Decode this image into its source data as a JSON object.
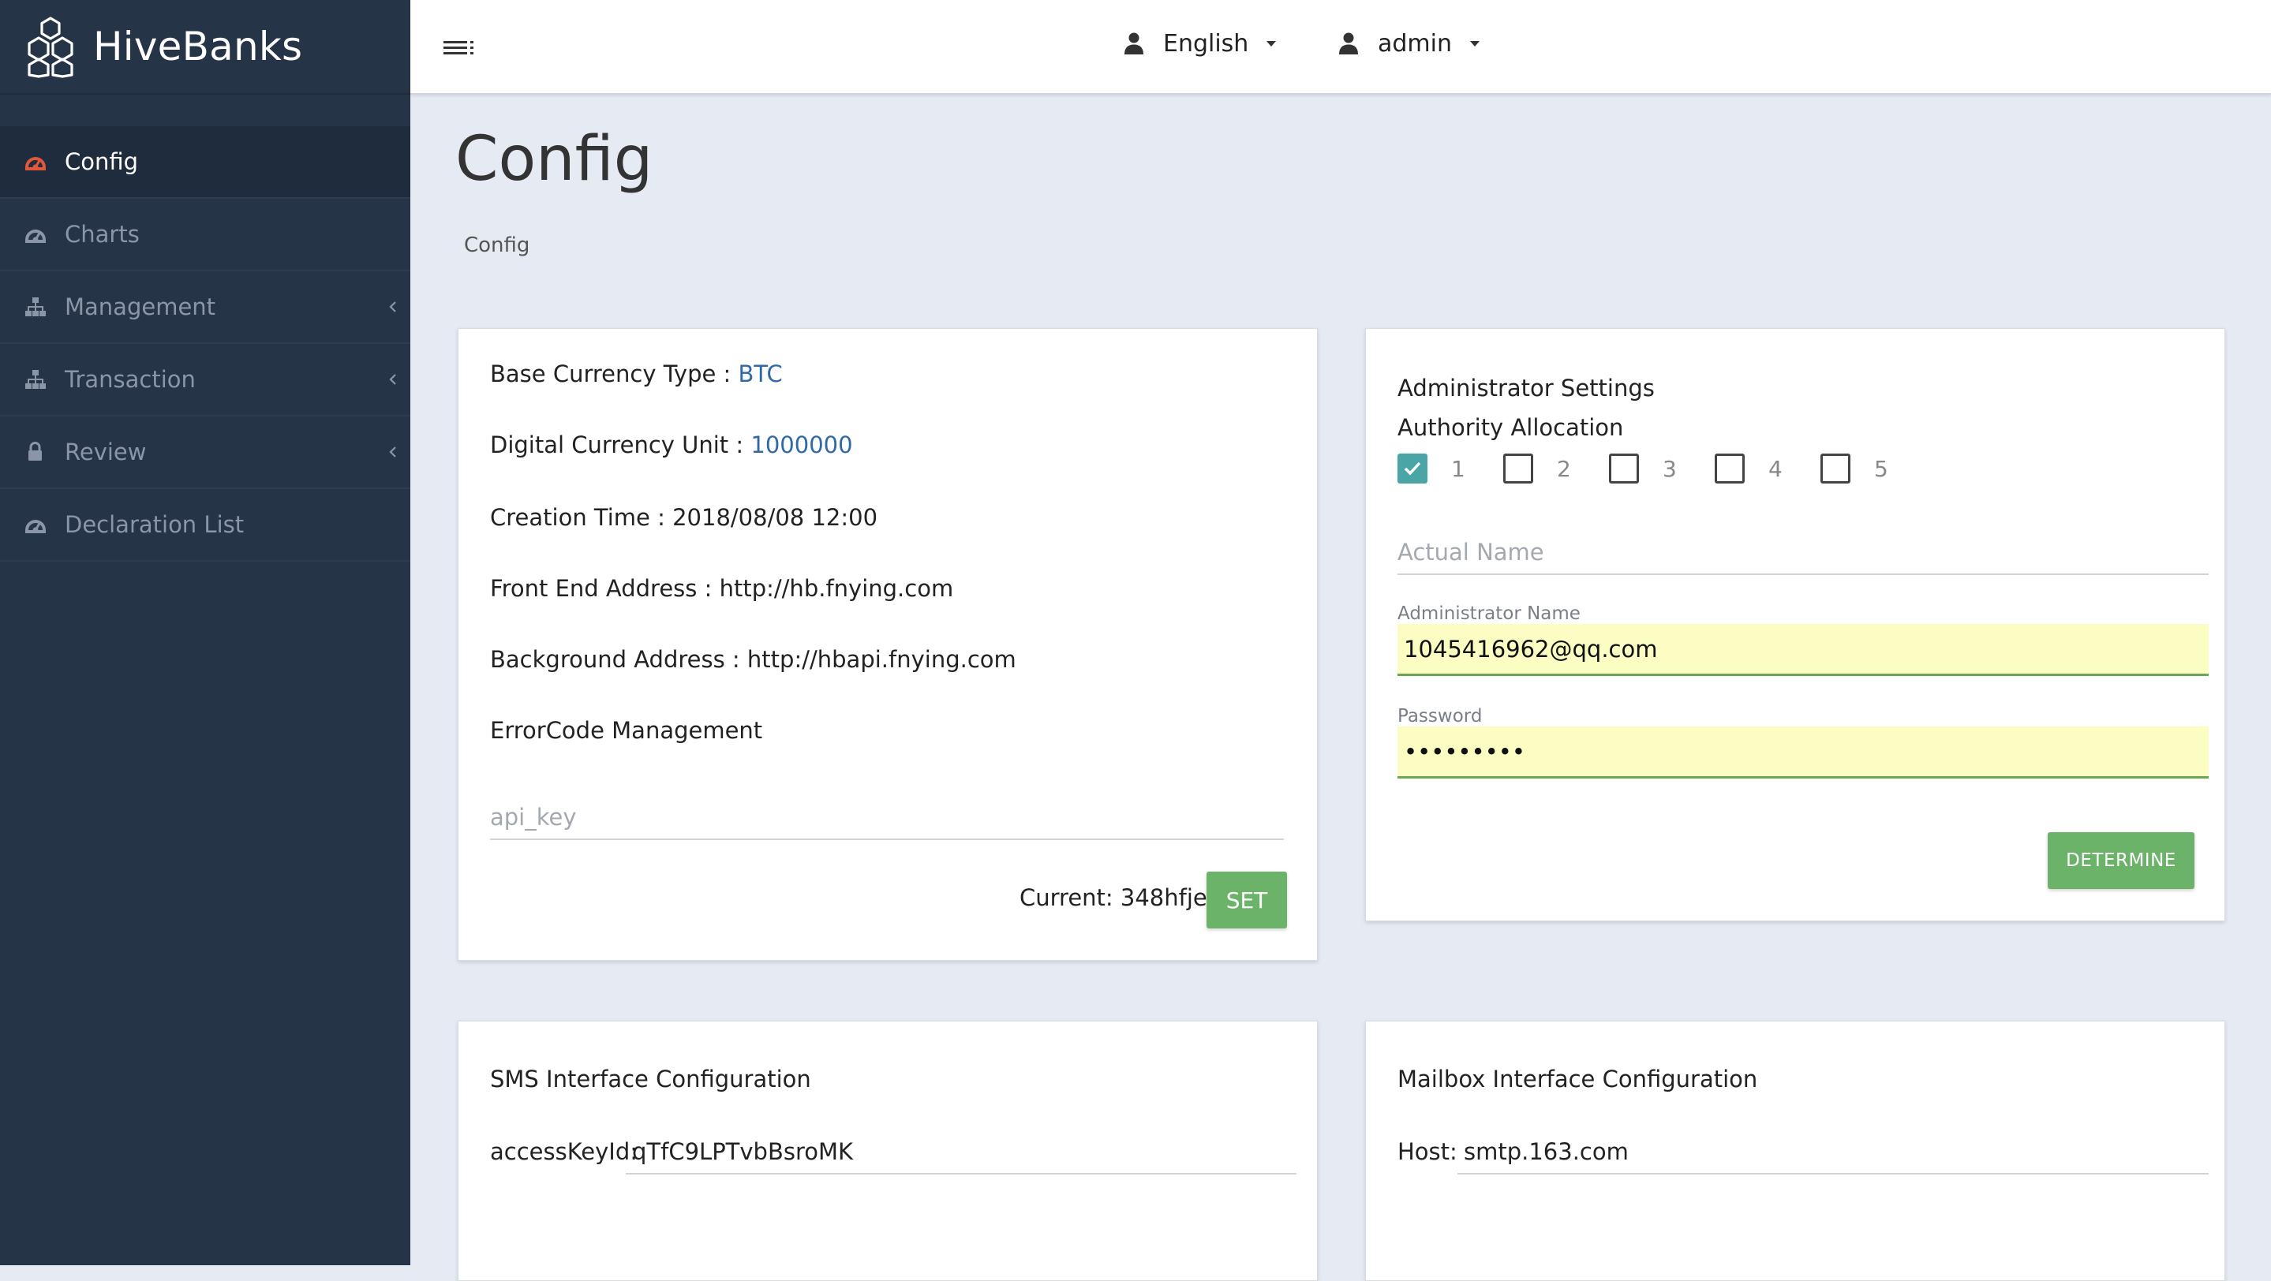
{
  "brand": {
    "name": "HiveBanks"
  },
  "sidebar": {
    "items": [
      {
        "label": "Config",
        "active": true
      },
      {
        "label": "Charts"
      },
      {
        "label": "Management"
      },
      {
        "label": "Transaction"
      },
      {
        "label": "Review"
      },
      {
        "label": "Declaration List"
      }
    ]
  },
  "topbar": {
    "language": "English",
    "user": "admin"
  },
  "page": {
    "title": "Config",
    "breadcrumb": "Config"
  },
  "base_card": {
    "base_currency_label": "Base Currency Type : ",
    "base_currency_value": "BTC",
    "unit_label": "Digital Currency Unit : ",
    "unit_value": "1000000",
    "creation_time": "Creation Time : 2018/08/08 12:00",
    "front_end": "Front End Address : http://hb.fnying.com",
    "background": "Background Address : http://hbapi.fnying.com",
    "errorcode_link": "ErrorCode Management",
    "api_key_placeholder": "api_key",
    "current": "Current: 348hfjeh",
    "set_button": "SET"
  },
  "admin_card": {
    "title": "Administrator Settings",
    "authority": "Authority Allocation",
    "checkboxes": [
      {
        "label": "1",
        "checked": true
      },
      {
        "label": "2",
        "checked": false
      },
      {
        "label": "3",
        "checked": false
      },
      {
        "label": "4",
        "checked": false
      },
      {
        "label": "5",
        "checked": false
      }
    ],
    "actual_name_placeholder": "Actual Name",
    "admin_name_label": "Administrator Name",
    "admin_name_value": "1045416962@qq.com",
    "password_label": "Password",
    "password_value": "•••••••••",
    "determine_button": "DETERMINE"
  },
  "sms_card": {
    "title": "SMS Interface Configuration",
    "access_key_label": "accessKeyId:",
    "access_key_value": "qTfC9LPTvbBsroMK"
  },
  "mail_card": {
    "title": "Mailbox Interface Configuration",
    "host_label": "Host:",
    "host_value": "smtp.163.com"
  },
  "colors": {
    "sidebar_bg": "#263447",
    "page_bg": "#e6eaf2",
    "accent_green": "#6cb36a",
    "link_blue": "#2f6aa6",
    "config_icon_red": "#e0583a",
    "checkbox_teal": "#4aa6a6"
  },
  "icons": {
    "logo": "hexagon-cluster-logo",
    "config": "dashboard-gauge-icon",
    "charts": "dashboard-gauge-icon",
    "management": "sitemap-icon",
    "transaction": "sitemap-icon",
    "review": "lock-icon",
    "declaration": "dashboard-gauge-icon",
    "menu": "hamburger-list-icon",
    "user": "user-icon"
  }
}
